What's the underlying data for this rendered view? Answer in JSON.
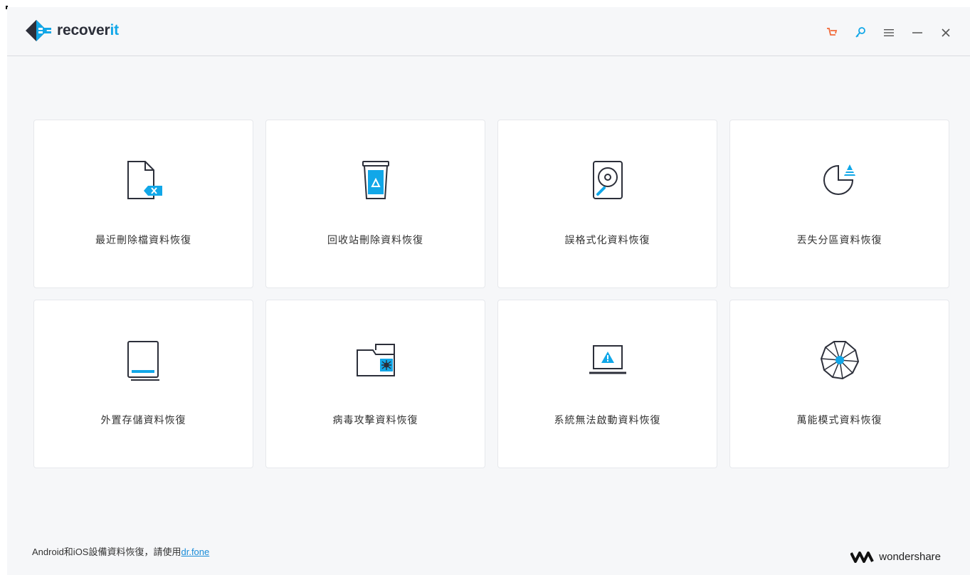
{
  "app": {
    "name_part1": "recover",
    "name_part2": "it"
  },
  "controls": {
    "icons": [
      "cart-icon",
      "key-icon",
      "menu-icon",
      "minimize-icon",
      "close-icon"
    ],
    "accent_cart": "#f26b3a",
    "accent_key": "#11a7e8"
  },
  "cards": [
    {
      "label": "最近刪除檔資料恢復",
      "icon": "deleted-file-icon"
    },
    {
      "label": "回收站刪除資料恢復",
      "icon": "recycle-bin-icon"
    },
    {
      "label": "誤格式化資料恢復",
      "icon": "formatted-disk-icon"
    },
    {
      "label": "丟失分區資料恢復",
      "icon": "lost-partition-icon"
    },
    {
      "label": "外置存儲資料恢復",
      "icon": "external-device-icon"
    },
    {
      "label": "病毒攻擊資料恢復",
      "icon": "virus-folder-icon"
    },
    {
      "label": "系統無法啟動資料恢復",
      "icon": "crashed-computer-icon"
    },
    {
      "label": "萬能模式資料恢復",
      "icon": "all-around-icon"
    }
  ],
  "footer": {
    "note": "Android和iOS設備資料恢復，請使用",
    "link": "dr.fone",
    "brand": "wondershare"
  },
  "colors": {
    "accent": "#11a7e8",
    "text": "#333333",
    "background": "#f6f7f9"
  }
}
